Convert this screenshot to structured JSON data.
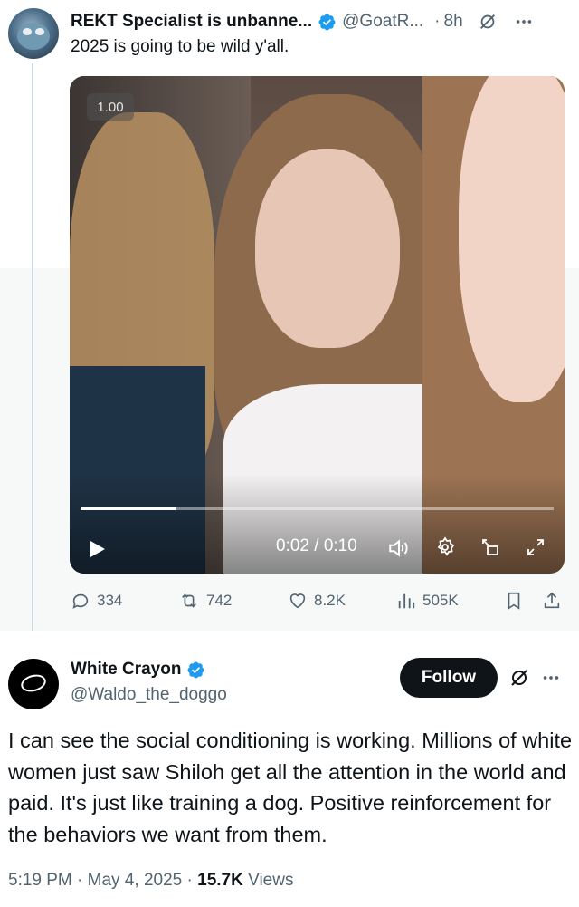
{
  "colors": {
    "accent": "#1d9bf0",
    "text": "#0f1419",
    "muted": "#536471",
    "follow_bg": "#0f1419"
  },
  "tweet1": {
    "display_name": "REKT Specialist is unbanne...",
    "handle": "@GoatR...",
    "time_ago": "8h",
    "text": "2025 is going to be wild y'all.",
    "video": {
      "playback_rate": "1.00",
      "time": "0:02 / 0:10",
      "progress_fraction": 0.2
    },
    "stats": {
      "replies": "334",
      "reposts": "742",
      "likes": "8.2K",
      "views": "505K"
    }
  },
  "tweet2": {
    "display_name": "White Crayon",
    "handle": "@Waldo_the_doggo",
    "follow_label": "Follow",
    "text": "I can see the social conditioning is working. Millions of white women just saw Shiloh get all the attention in the world and paid. It's just like training a dog. Positive reinforcement for the behaviors we want from them.",
    "time": "5:19 PM",
    "date": "May 4, 2025",
    "views_count": "15.7K",
    "views_label": "Views"
  },
  "icons": [
    "verified-badge-icon",
    "grok-icon",
    "more-icon",
    "play-icon",
    "volume-icon",
    "settings-icon",
    "pip-icon",
    "fullscreen-icon",
    "reply-icon",
    "repost-icon",
    "like-icon",
    "views-icon",
    "bookmark-icon",
    "share-icon"
  ]
}
